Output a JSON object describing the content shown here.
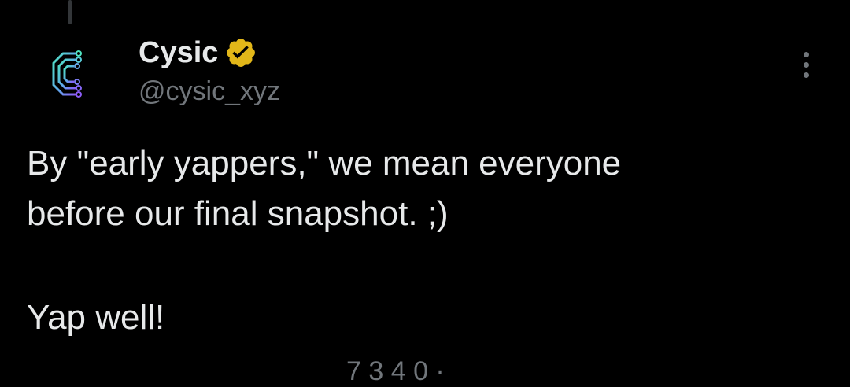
{
  "post": {
    "author": {
      "name": "Cysic",
      "handle": "@cysic_xyz",
      "verified": true,
      "avatar_icon": "cysic-logo-icon",
      "badge_icon": "verified-badge-icon",
      "badge_color": "#e2b719"
    },
    "more_icon": "more-options-icon",
    "text_lines": [
      "By \"early yappers,\" we mean everyone",
      "before our final snapshot. ;)"
    ],
    "text_lines_after_break": [
      "Yap well!"
    ],
    "views_partial": "7 3 4 0 ·"
  },
  "colors": {
    "background": "#000000",
    "primary_text": "#e7e9ea",
    "secondary_text": "#71767b",
    "logo_gradient_start": "#4fe3c1",
    "logo_gradient_end": "#8b5cf6"
  }
}
